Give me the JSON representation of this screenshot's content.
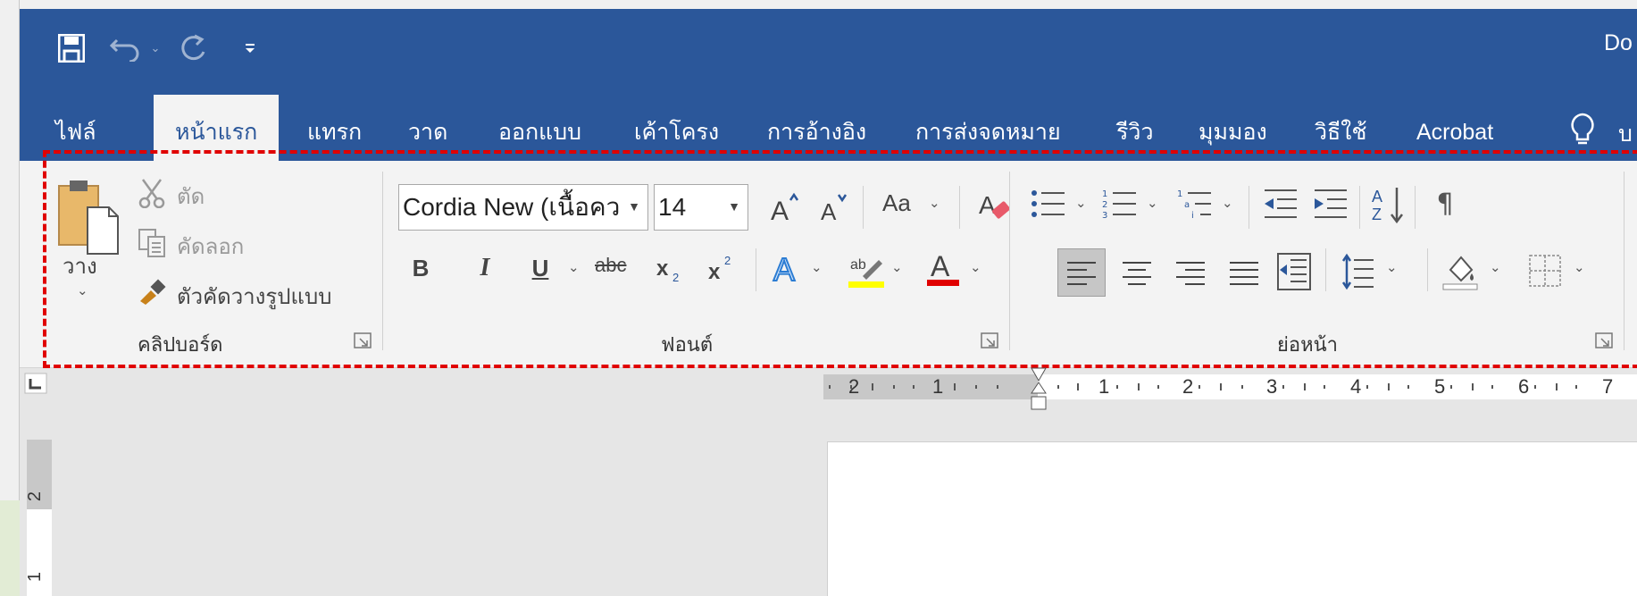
{
  "title_bar": {
    "doc_title": "Do",
    "quick_access": [
      {
        "name": "save-icon"
      },
      {
        "name": "undo-icon"
      },
      {
        "name": "redo-icon"
      },
      {
        "name": "customize-qat-icon"
      }
    ]
  },
  "tabs": [
    {
      "label": "ไฟล์",
      "active": false
    },
    {
      "label": "หน้าแรก",
      "active": true
    },
    {
      "label": "แทรก",
      "active": false
    },
    {
      "label": "วาด",
      "active": false
    },
    {
      "label": "ออกแบบ",
      "active": false
    },
    {
      "label": "เค้าโครง",
      "active": false
    },
    {
      "label": "การอ้างอิง",
      "active": false
    },
    {
      "label": "การส่งจดหมาย",
      "active": false
    },
    {
      "label": "รีวิว",
      "active": false
    },
    {
      "label": "มุมมอง",
      "active": false
    },
    {
      "label": "วิธีใช้",
      "active": false
    },
    {
      "label": "Acrobat",
      "active": false
    }
  ],
  "tell_me": {
    "icon": "lightbulb-icon",
    "text": "บ"
  },
  "ribbon": {
    "clipboard": {
      "paste_label": "วาง",
      "cut_label": "ตัด",
      "copy_label": "คัดลอก",
      "format_painter_label": "ตัวคัดวางรูปแบบ",
      "group_label": "คลิปบอร์ด"
    },
    "font": {
      "font_name": "Cordia New (เนื้อคว",
      "font_size": "14",
      "change_case_label": "Aa",
      "strikethrough_label": "abc",
      "group_label": "ฟอนต์",
      "highlight_color": "#ffff00",
      "font_color": "#e00000"
    },
    "paragraph": {
      "group_label": "ย่อหน้า"
    },
    "highlight_border_color": "#e00000",
    "accent_color": "#2b579a"
  },
  "ruler": {
    "left_labels": [
      "2",
      "1"
    ],
    "right_labels": [
      "1",
      "2",
      "3",
      "4",
      "5",
      "6",
      "7"
    ]
  },
  "vertical_ruler": {
    "labels": [
      "2",
      "1"
    ]
  }
}
